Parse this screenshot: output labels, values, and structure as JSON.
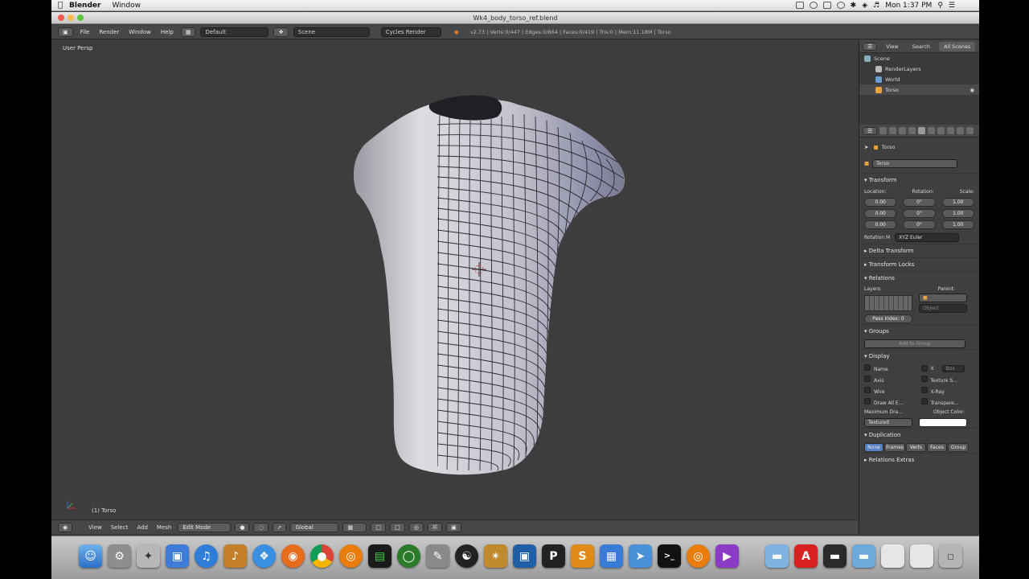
{
  "menubar": {
    "app_name": "Blender",
    "menus": [
      "Window"
    ],
    "clock": "Mon 1:37 PM"
  },
  "window": {
    "title": "Wk4_body_torso_ref.blend"
  },
  "info_header": {
    "menus": [
      "File",
      "Render",
      "Window",
      "Help"
    ],
    "screen_layout": "Default",
    "scene": "Scene",
    "render_engine": "Cycles Render",
    "stats": "v2.73 | Verts:0/447 | Edges:0/864 | Faces:0/419 | Tris:0 | Mem:11.18M | Torso"
  },
  "viewport": {
    "view_label": "User Persp",
    "object_label": "(1) Torso"
  },
  "view_header": {
    "menus": [
      "View",
      "Select",
      "Add",
      "Mesh"
    ],
    "mode": "Edit Mode",
    "orientation": "Global"
  },
  "outliner": {
    "tabs": [
      "View",
      "Search",
      "All Scenes"
    ],
    "active_tab": "All Scenes",
    "items": [
      {
        "label": "Scene",
        "icon_color": "#8ab"
      },
      {
        "label": "RenderLayers",
        "icon_color": "#bbb"
      },
      {
        "label": "World",
        "icon_color": "#6a9fd6"
      },
      {
        "label": "Torso",
        "icon_color": "#e8a33a"
      }
    ]
  },
  "properties": {
    "breadcrumb": "Torso",
    "object_name": "Torso",
    "transform": {
      "title": "Transform",
      "col_labels": [
        "Location:",
        "Rotation:",
        "Scale:"
      ],
      "location": [
        "0.00",
        "0.00",
        "0.00"
      ],
      "rotation": [
        "0°",
        "0°",
        "0°"
      ],
      "scale": [
        "1.00",
        "1.00",
        "1.00"
      ],
      "rotation_mode_label": "Rotation M",
      "rotation_mode": "XYZ Euler"
    },
    "collapsed_sections": [
      "Delta Transform",
      "Transform Locks"
    ],
    "relations": {
      "title": "Relations",
      "layers_label": "Layers:",
      "parent_label": "Parent:",
      "parent_type": "Object",
      "pass_index": "Pass Index: 0"
    },
    "groups": {
      "title": "Groups",
      "add_button": "Add to Group"
    },
    "display": {
      "title": "Display",
      "options_left": [
        "Name",
        "Axis",
        "Wire",
        "Draw All E..."
      ],
      "options_right": [
        "X",
        "Texture S...",
        "X-Ray",
        "Transpare..."
      ],
      "bounds_value": "Box",
      "maximum_draw_label": "Maximum Dra...",
      "maximum_draw_value": "Textured",
      "object_color_label": "Object Color:"
    },
    "duplication": {
      "title": "Duplication",
      "options": [
        "None",
        "Frames",
        "Verts",
        "Faces",
        "Group"
      ],
      "active": "None"
    },
    "relations_extras": "Relations Extras"
  },
  "dock": {
    "icons": [
      "finder-icon",
      "system-preferences-icon",
      "safari-compass-icon",
      "preview-icon",
      "itunes-icon",
      "garageband-icon",
      "safari-icon",
      "firefox-icon",
      "chrome-icon",
      "blender-icon",
      "activity-monitor-icon",
      "iterm-icon",
      "script-editor-icon",
      "cinema-icon",
      "flash-icon",
      "app-icon",
      "p-app-icon",
      "sublime-icon",
      "tetris-icon",
      "xcode-icon",
      "terminal-icon",
      "blender-2-icon",
      "flash-player-icon",
      "folder-icon",
      "adobe-icon",
      "downloads-icon",
      "applications-icon",
      "window-1-icon",
      "window-2-icon",
      "trash-icon"
    ]
  }
}
